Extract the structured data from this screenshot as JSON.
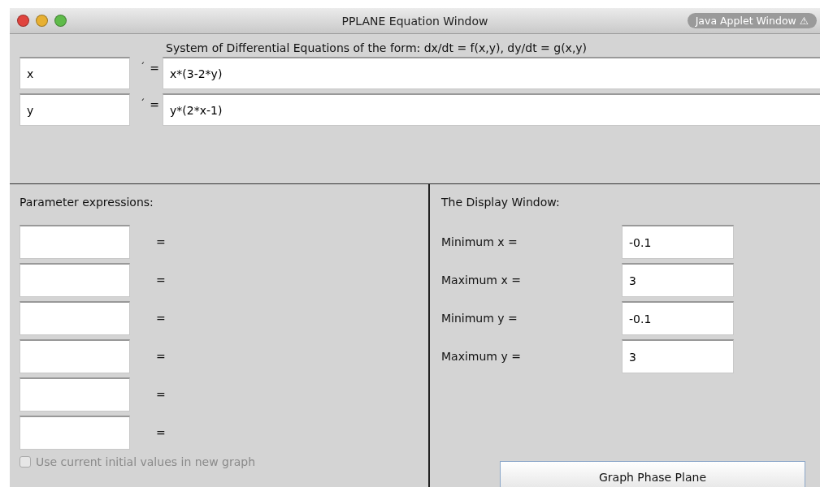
{
  "window": {
    "title": "PPLANE Equation Window",
    "badge": "Java Applet Window ⚠"
  },
  "equations": {
    "heading": "System of Differential Equations of the form: dx/dt = f(x,y), dy/dt = g(x,y)",
    "rows": [
      {
        "variable": "x",
        "prime": "´",
        "equals": "=",
        "expression": "x*(3-2*y)"
      },
      {
        "variable": "y",
        "prime": "´",
        "equals": "=",
        "expression": "y*(2*x-1)"
      }
    ]
  },
  "parameters": {
    "heading": "Parameter expressions:",
    "rows": [
      {
        "equals": "="
      },
      {
        "equals": "="
      },
      {
        "equals": "="
      },
      {
        "equals": "="
      },
      {
        "equals": "="
      },
      {
        "equals": "="
      }
    ],
    "checkbox": {
      "label": "Use current initial values in new graph",
      "checked": false,
      "disabled": true
    }
  },
  "display": {
    "heading": "The Display Window:",
    "fields": [
      {
        "label": "Minimum x =",
        "value": "-0.1"
      },
      {
        "label": "Maximum x =",
        "value": "3"
      },
      {
        "label": "Minimum y =",
        "value": "-0.1"
      },
      {
        "label": "Maximum y =",
        "value": "3"
      }
    ],
    "button": "Graph Phase Plane"
  }
}
